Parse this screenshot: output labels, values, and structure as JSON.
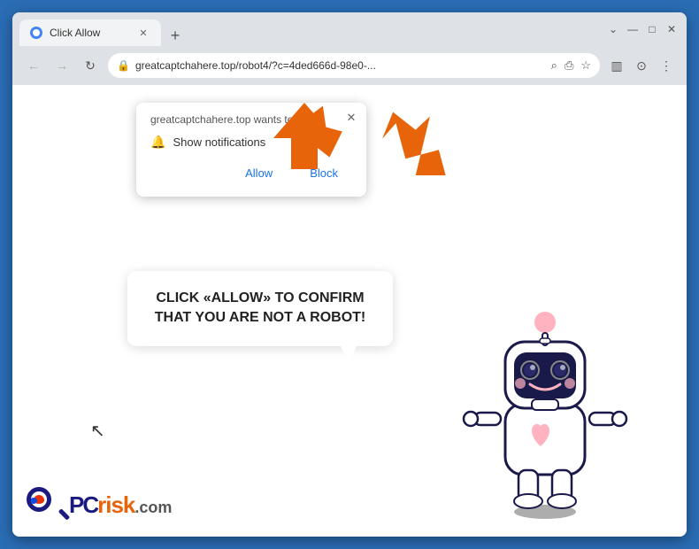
{
  "browser": {
    "tab": {
      "title": "Click Allow",
      "favicon_color": "#4285f4"
    },
    "new_tab_icon": "+",
    "window_controls": {
      "chevron": "⌄",
      "minimize": "—",
      "maximize": "□",
      "close": "✕"
    },
    "address_bar": {
      "url": "greatcaptchahere.top/robot4/?c=4ded666d-98e0-...",
      "lock_icon": "🔒"
    },
    "toolbar": {
      "search_icon": "⌕",
      "share_icon": "⎙",
      "star_icon": "☆",
      "sidebar_icon": "▥",
      "profile_icon": "⊙",
      "menu_icon": "⋮"
    }
  },
  "notification_popup": {
    "header": "greatcaptchahere.top wants to...",
    "row_label": "Show notifications",
    "allow_btn": "Allow",
    "block_btn": "Block",
    "close_icon": "✕"
  },
  "speech_bubble": {
    "text": "CLICK «ALLOW» TO CONFIRM THAT YOU ARE NOT A ROBOT!"
  },
  "pcrisk": {
    "pc": "PC",
    "risk": "risk",
    "domain": ".com"
  },
  "arrow": {
    "color": "#e8640a"
  }
}
